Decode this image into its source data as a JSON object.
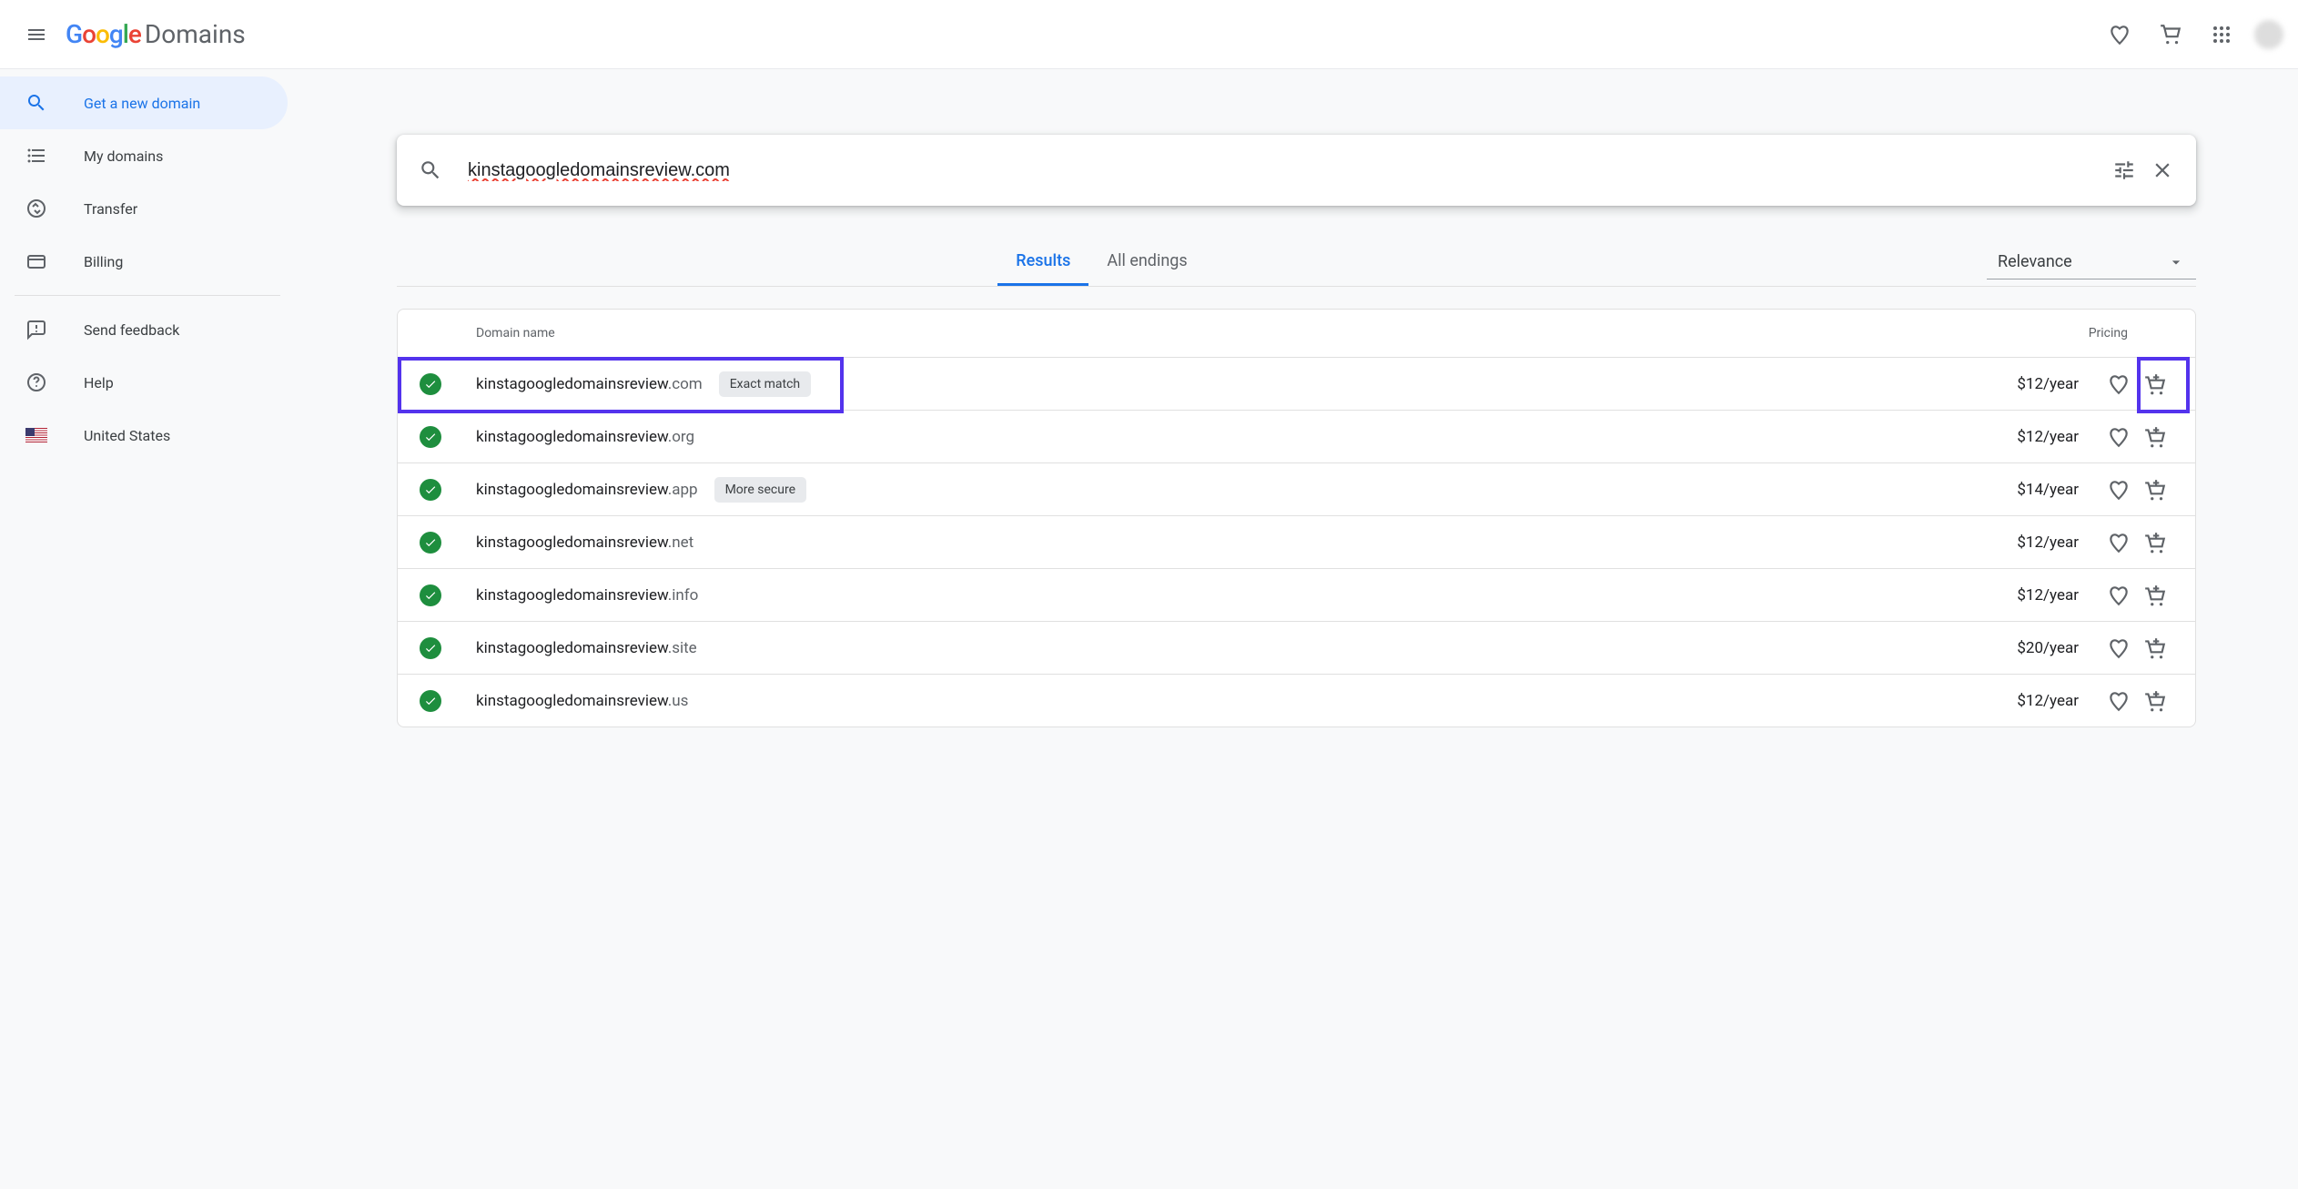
{
  "header": {
    "product_name": "Domains"
  },
  "sidebar": {
    "items": [
      {
        "label": "Get a new domain",
        "active": true
      },
      {
        "label": "My domains"
      },
      {
        "label": "Transfer"
      },
      {
        "label": "Billing"
      },
      {
        "label": "Send feedback"
      },
      {
        "label": "Help"
      },
      {
        "label": "United States"
      }
    ]
  },
  "search": {
    "value": "kinstagoogledomainsreview.com"
  },
  "tabs": {
    "results": "Results",
    "all_endings": "All endings"
  },
  "sort": {
    "selected": "Relevance"
  },
  "columns": {
    "name": "Domain name",
    "price": "Pricing"
  },
  "results": [
    {
      "name": "kinstagoogledomainsreview",
      "tld": ".com",
      "badge": "Exact match",
      "price": "$12/year"
    },
    {
      "name": "kinstagoogledomainsreview",
      "tld": ".org",
      "price": "$12/year"
    },
    {
      "name": "kinstagoogledomainsreview",
      "tld": ".app",
      "badge": "More secure",
      "price": "$14/year"
    },
    {
      "name": "kinstagoogledomainsreview",
      "tld": ".net",
      "price": "$12/year"
    },
    {
      "name": "kinstagoogledomainsreview",
      "tld": ".info",
      "price": "$12/year"
    },
    {
      "name": "kinstagoogledomainsreview",
      "tld": ".site",
      "price": "$20/year"
    },
    {
      "name": "kinstagoogledomainsreview",
      "tld": ".us",
      "price": "$12/year"
    }
  ]
}
